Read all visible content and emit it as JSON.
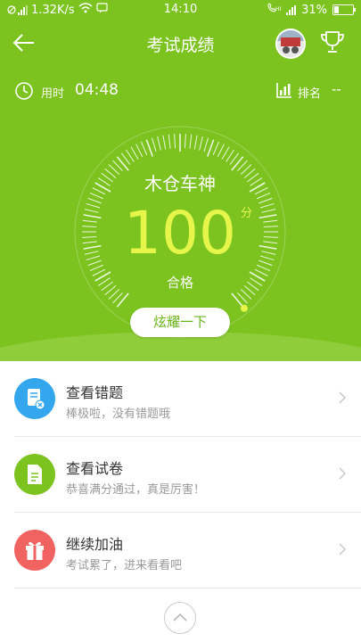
{
  "status_bar": {
    "network_speed": "1.32K/s",
    "time": "14:10",
    "battery": "31%"
  },
  "nav": {
    "title": "考试成绩",
    "icons": [
      "back-arrow-icon",
      "avatar",
      "trophy-icon"
    ]
  },
  "stats": {
    "time_label": "用时",
    "time_value": "04:48",
    "rank_label": "排名",
    "rank_value": "--"
  },
  "result": {
    "nickname": "木仓车神",
    "score": "100",
    "score_unit": "分",
    "status": "合格",
    "score_ratio": 1.0,
    "share_button": "炫耀一下"
  },
  "actions": [
    {
      "title": "查看错题",
      "subtitle": "棒极啦，没有错题哦",
      "icon": "wrong-questions-icon",
      "color": "#33a6ee"
    },
    {
      "title": "查看试卷",
      "subtitle": "恭喜满分通过，真是厉害！",
      "icon": "paper-icon",
      "color": "#7cc320"
    },
    {
      "title": "继续加油",
      "subtitle": "考试累了，进来看看吧",
      "icon": "gift-icon",
      "color": "#f16361"
    }
  ],
  "colors": {
    "primary_green": "#7cc320",
    "score_yellow": "#e6f54a"
  }
}
